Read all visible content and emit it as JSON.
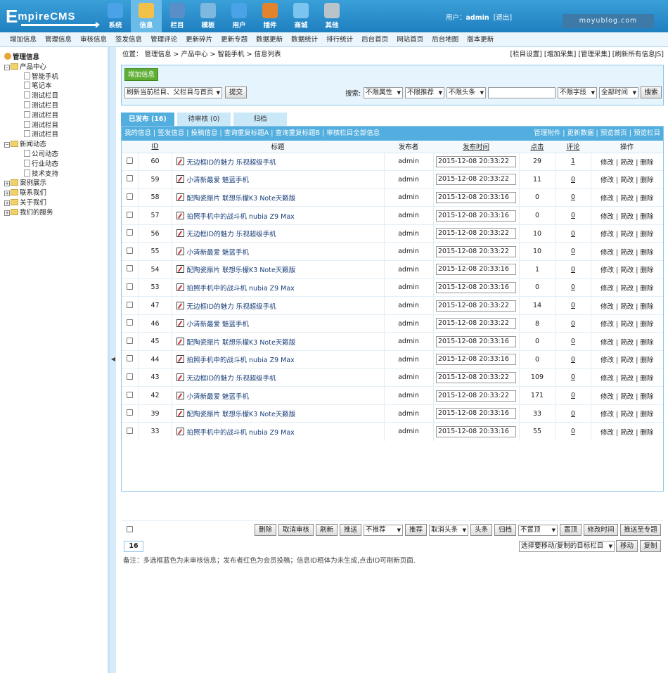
{
  "header": {
    "logo_first": "E",
    "logo_rest": "mpireCMS",
    "nav": [
      {
        "label": "系统",
        "icon": "globe-icon",
        "color": "#4aa3e6"
      },
      {
        "label": "信息",
        "icon": "notepad-icon",
        "color": "#f3c14a"
      },
      {
        "label": "栏目",
        "icon": "folder-icon",
        "color": "#5a8ec9"
      },
      {
        "label": "模板",
        "icon": "window-icon",
        "color": "#7db8e0"
      },
      {
        "label": "用户",
        "icon": "user-icon",
        "color": "#4aa3e6"
      },
      {
        "label": "插件",
        "icon": "tools-icon",
        "color": "#e2842e"
      },
      {
        "label": "商城",
        "icon": "shop-icon",
        "color": "#7bc4f0"
      },
      {
        "label": "其他",
        "icon": "gear-icon",
        "color": "#b9c3cc"
      }
    ],
    "user_label": "用户：",
    "user_name": "admin",
    "logout": "[退出]",
    "watermark": "moyublog.com"
  },
  "menubar": [
    "增加信息",
    "管理信息",
    "审核信息",
    "签发信息",
    "管理评论",
    "更新碎片",
    "更新专题",
    "数据更新",
    "数据统计",
    "排行统计",
    "后台首页",
    "网站首页",
    "后台地图",
    "版本更新"
  ],
  "sidebar": {
    "root": "管理信息",
    "groups": [
      {
        "label": "产品中心",
        "expanded": true,
        "children": [
          "智能手机",
          "笔记本",
          "测试栏目",
          "测试栏目",
          "测试栏目",
          "测试栏目",
          "测试栏目"
        ]
      },
      {
        "label": "新闻动态",
        "expanded": true,
        "children": [
          "公司动态",
          "行业动态",
          "技术支持"
        ]
      },
      {
        "label": "案例展示",
        "expanded": false,
        "children": []
      },
      {
        "label": "联系我们",
        "expanded": false,
        "children": []
      },
      {
        "label": "关于我们",
        "expanded": false,
        "children": []
      },
      {
        "label": "我们的服务",
        "expanded": false,
        "children": []
      }
    ]
  },
  "main": {
    "crumb": "位置：  管理信息 > 产品中心 > 智能手机 > 信息列表",
    "toplinks": "[栏目设置] [增加采集] [管理采集] [刷新所有信息JS]",
    "add_button": "增加信息",
    "refresh_select": "刷新当前栏目、父栏目与首页",
    "submit_button": "提交",
    "search_label": "搜索:",
    "attr_select": "不限属性",
    "recommend_select": "不限推荐",
    "headline_select": "不限头条",
    "field_select": "不限字段",
    "time_select": "全部时间",
    "search_button": "搜索",
    "tabs": [
      "已发布 (16)",
      "待审核 (0)",
      "归档"
    ],
    "actionbar_left": "我的信息 | 签发信息 | 投稿信息 | 查询重复标题A | 查询重复标题B | 审核栏目全部信息",
    "actionbar_right": "管理附件 | 更新数据 | 预览首页 | 预览栏目",
    "columns": [
      "ID",
      "标题",
      "发布者",
      "发布时间",
      "点击",
      "评论",
      "操作"
    ],
    "ops": "修改 | 简改 | 删除",
    "rows": [
      {
        "id": "60",
        "title": "无边框ID的魅力 乐视超级手机",
        "author": "admin",
        "time": "2015-12-08 20:33:22",
        "hits": "29",
        "comments": "1"
      },
      {
        "id": "59",
        "title": "小清新最爱 魅蓝手机",
        "author": "admin",
        "time": "2015-12-08 20:33:22",
        "hits": "11",
        "comments": "0"
      },
      {
        "id": "58",
        "title": "配陶瓷振片 联想乐檬K3 Note天籁版",
        "author": "admin",
        "time": "2015-12-08 20:33:16",
        "hits": "0",
        "comments": "0"
      },
      {
        "id": "57",
        "title": "拍照手机中的战斗机 nubia Z9 Max",
        "author": "admin",
        "time": "2015-12-08 20:33:16",
        "hits": "0",
        "comments": "0"
      },
      {
        "id": "56",
        "title": "无边框ID的魅力 乐视超级手机",
        "author": "admin",
        "time": "2015-12-08 20:33:22",
        "hits": "10",
        "comments": "0"
      },
      {
        "id": "55",
        "title": "小清新最爱 魅蓝手机",
        "author": "admin",
        "time": "2015-12-08 20:33:22",
        "hits": "10",
        "comments": "0"
      },
      {
        "id": "54",
        "title": "配陶瓷振片 联想乐檬K3 Note天籁版",
        "author": "admin",
        "time": "2015-12-08 20:33:16",
        "hits": "1",
        "comments": "0"
      },
      {
        "id": "53",
        "title": "拍照手机中的战斗机 nubia Z9 Max",
        "author": "admin",
        "time": "2015-12-08 20:33:16",
        "hits": "0",
        "comments": "0"
      },
      {
        "id": "47",
        "title": "无边框ID的魅力 乐视超级手机",
        "author": "admin",
        "time": "2015-12-08 20:33:22",
        "hits": "14",
        "comments": "0"
      },
      {
        "id": "46",
        "title": "小清新最爱 魅蓝手机",
        "author": "admin",
        "time": "2015-12-08 20:33:22",
        "hits": "8",
        "comments": "0"
      },
      {
        "id": "45",
        "title": "配陶瓷振片 联想乐檬K3 Note天籁版",
        "author": "admin",
        "time": "2015-12-08 20:33:16",
        "hits": "0",
        "comments": "0"
      },
      {
        "id": "44",
        "title": "拍照手机中的战斗机 nubia Z9 Max",
        "author": "admin",
        "time": "2015-12-08 20:33:16",
        "hits": "0",
        "comments": "0"
      },
      {
        "id": "43",
        "title": "无边框ID的魅力 乐视超级手机",
        "author": "admin",
        "time": "2015-12-08 20:33:22",
        "hits": "109",
        "comments": "0"
      },
      {
        "id": "42",
        "title": "小清新最爱 魅蓝手机",
        "author": "admin",
        "time": "2015-12-08 20:33:22",
        "hits": "171",
        "comments": "0"
      },
      {
        "id": "39",
        "title": "配陶瓷振片 联想乐檬K3 Note天籁版",
        "author": "admin",
        "time": "2015-12-08 20:33:16",
        "hits": "33",
        "comments": "0"
      },
      {
        "id": "33",
        "title": "拍照手机中的战斗机 nubia Z9 Max",
        "author": "admin",
        "time": "2015-12-08 20:33:16",
        "hits": "55",
        "comments": "0"
      }
    ],
    "bottom": {
      "delete": "删除",
      "cancel_review": "取消审核",
      "refresh": "刷新",
      "push": "推送",
      "recommend_select": "不推荐",
      "recommend": "推荐",
      "cancel_headline_select": "取消头条",
      "headline": "头条",
      "archive": "归档",
      "top_select": "不置顶",
      "top": "置顶",
      "modify_time": "修改时间",
      "push_special": "推送至专题"
    },
    "page": "16",
    "move_select": "选择要移动/复制的目标栏目",
    "move": "移动",
    "copy": "复制",
    "note": "备注：多选框蓝色为未审核信息；发布者红色为会员投稿；信息ID粗体为未生成,点击ID可刷新页面."
  }
}
